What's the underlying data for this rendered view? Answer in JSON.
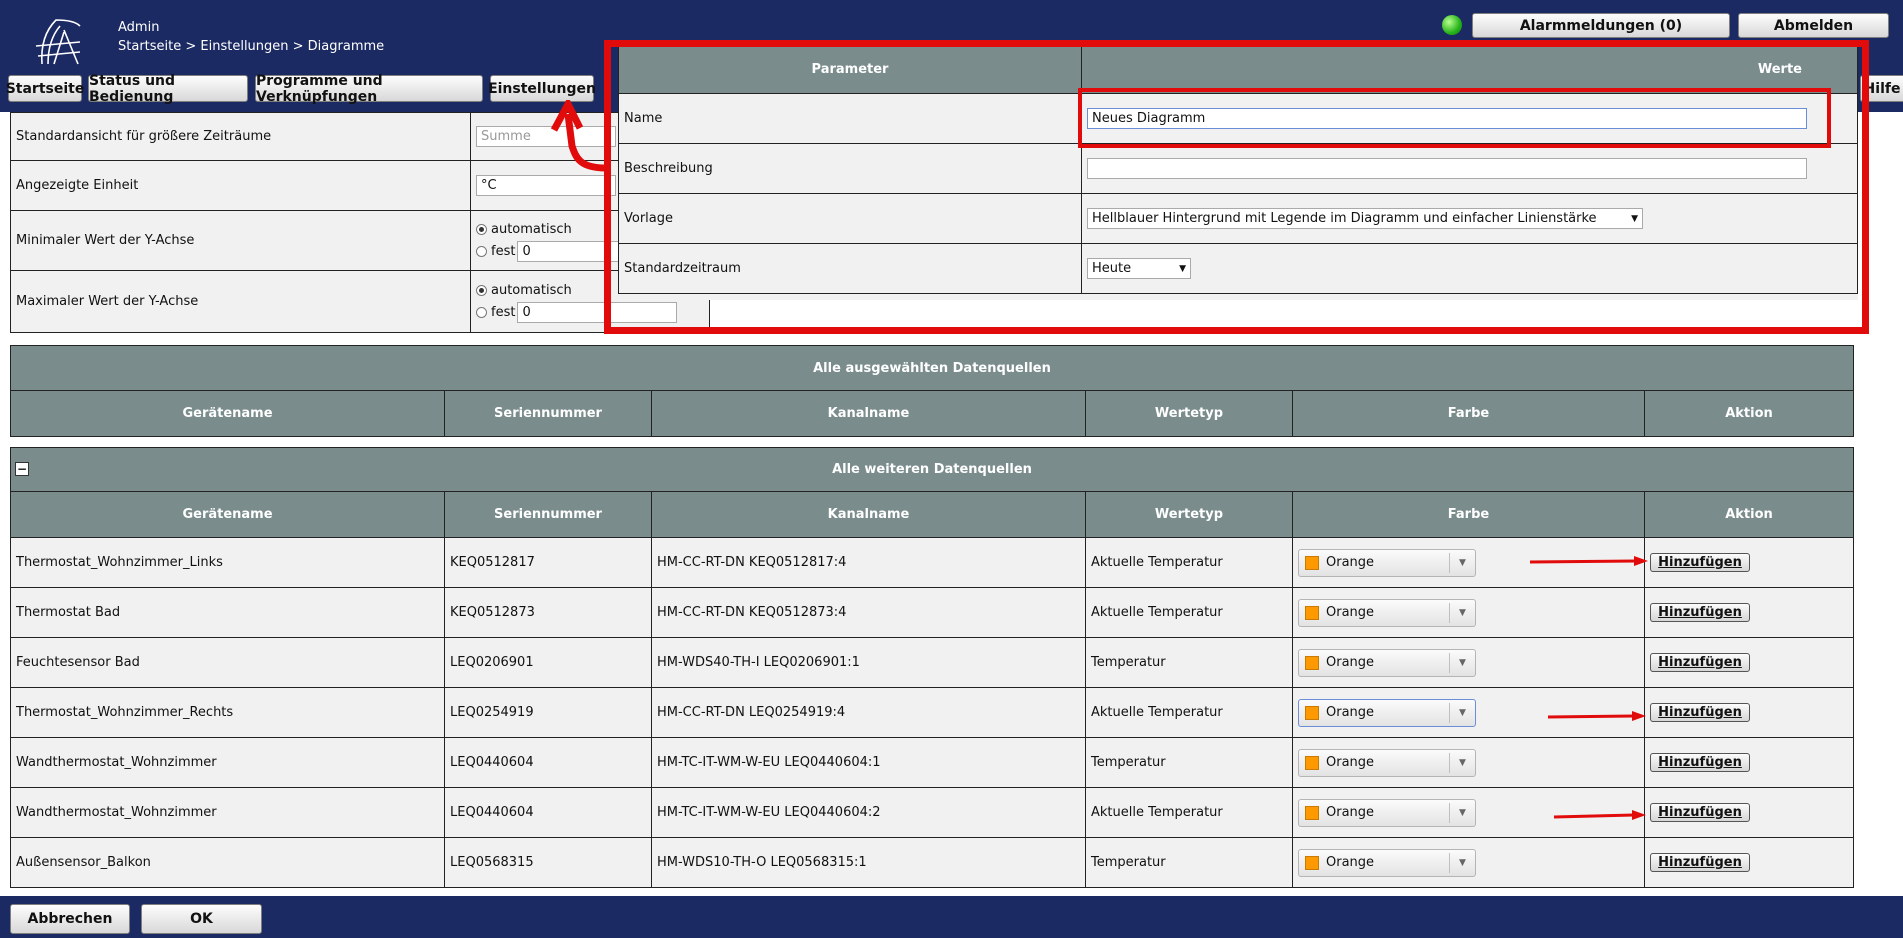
{
  "header": {
    "user": "Admin",
    "breadcrumb": "Startseite > Einstellungen > Diagramme",
    "nav": [
      "Startseite",
      "Status und Bedienung",
      "Programme und Verknüpfungen",
      "Einstellungen"
    ],
    "help": "Hilfe",
    "alarm": "Alarmmeldungen (0)",
    "logout": "Abmelden"
  },
  "settings": {
    "rows": [
      {
        "label": "Standardansicht für größere Zeiträume",
        "value": "Summe"
      },
      {
        "label": "Angezeigte Einheit",
        "value": "°C"
      },
      {
        "label": "Minimaler Wert der Y-Achse",
        "auto": "automatisch",
        "fixed": "fest",
        "fixed_value": "0"
      },
      {
        "label": "Maximaler Wert der Y-Achse",
        "auto": "automatisch",
        "fixed": "fest",
        "fixed_value": "0"
      }
    ]
  },
  "params": {
    "header_param": "Parameter",
    "header_values": "Werte",
    "name_label": "Name",
    "name_value": "Neues Diagramm",
    "desc_label": "Beschreibung",
    "desc_value": "",
    "template_label": "Vorlage",
    "template_value": "Hellblauer Hintergrund mit Legende im Diagramm und einfacher Linienstärke",
    "period_label": "Standardzeitraum",
    "period_value": "Heute"
  },
  "selected": {
    "title": "Alle ausgewählten Datenquellen",
    "columns": [
      "Gerätename",
      "Seriennummer",
      "Kanalname",
      "Wertetyp",
      "Farbe",
      "Aktion"
    ]
  },
  "others": {
    "title": "Alle weiteren Datenquellen",
    "columns": [
      "Gerätename",
      "Seriennummer",
      "Kanalname",
      "Wertetyp",
      "Farbe",
      "Aktion"
    ],
    "add_label": "Hinzufügen",
    "rows": [
      {
        "device": "Thermostat_Wohnzimmer_Links",
        "serial": "KEQ0512817",
        "channel": "HM-CC-RT-DN KEQ0512817:4",
        "type": "Aktuelle Temperatur",
        "color": "Orange"
      },
      {
        "device": "Thermostat Bad",
        "serial": "KEQ0512873",
        "channel": "HM-CC-RT-DN KEQ0512873:4",
        "type": "Aktuelle Temperatur",
        "color": "Orange"
      },
      {
        "device": "Feuchtesensor Bad",
        "serial": "LEQ0206901",
        "channel": "HM-WDS40-TH-I LEQ0206901:1",
        "type": "Temperatur",
        "color": "Orange"
      },
      {
        "device": "Thermostat_Wohnzimmer_Rechts",
        "serial": "LEQ0254919",
        "channel": "HM-CC-RT-DN LEQ0254919:4",
        "type": "Aktuelle Temperatur",
        "color": "Orange"
      },
      {
        "device": "Wandthermostat_Wohnzimmer",
        "serial": "LEQ0440604",
        "channel": "HM-TC-IT-WM-W-EU LEQ0440604:1",
        "type": "Temperatur",
        "color": "Orange"
      },
      {
        "device": "Wandthermostat_Wohnzimmer",
        "serial": "LEQ0440604",
        "channel": "HM-TC-IT-WM-W-EU LEQ0440604:2",
        "type": "Aktuelle Temperatur",
        "color": "Orange"
      },
      {
        "device": "Außensensor_Balkon",
        "serial": "LEQ0568315",
        "channel": "HM-WDS10-TH-O LEQ0568315:1",
        "type": "Temperatur",
        "color": "Orange"
      }
    ]
  },
  "footer": {
    "cancel": "Abbrechen",
    "ok": "OK"
  },
  "colors": {
    "header_bg": "#1c2a63",
    "table_header": "#7a8c8c",
    "annotation_red": "#e10b0b",
    "swatch_orange": "#ff9900"
  }
}
